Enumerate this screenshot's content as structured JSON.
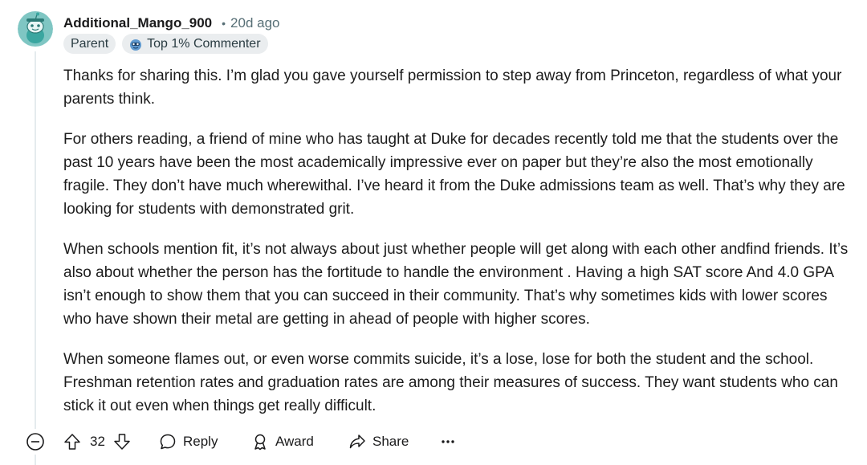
{
  "comment": {
    "username": "Additional_Mango_900",
    "separator": "•",
    "timestamp": "20d ago",
    "avatar_icon": "snoo-avatar-icon",
    "flairs": [
      {
        "label": "Parent"
      },
      {
        "label": "Top 1% Commenter",
        "icon": "commenter-badge-icon"
      }
    ],
    "paragraphs": [
      "Thanks for sharing this. I’m glad you gave yourself permission to step away from Princeton, regardless of what your parents think.",
      "For others reading, a friend of mine who has taught at Duke for decades recently told me that the students over the past 10 years have been the most academically impressive ever on paper but they’re also the most emotionally fragile. They don’t have much wherewithal. I’ve heard it from the Duke admissions team as well. That’s why they are looking for students with demonstrated grit.",
      "When schools mention fit, it’s not always about just whether people will get along with each other andfind friends. It’s also about whether the person has the fortitude to handle the environment . Having a high SAT score And 4.0 GPA isn’t enough to show them that you can succeed in their community. That’s why sometimes kids with lower scores who have shown their metal are getting in ahead of people with higher scores.",
      "When someone flames out, or even worse commits suicide, it’s a lose, lose for both the student and the school. Freshman retention rates and graduation rates are among their measures of success. They want students who can stick it out even when things get really difficult."
    ]
  },
  "actions": {
    "vote_count": "32",
    "reply_label": "Reply",
    "award_label": "Award",
    "share_label": "Share",
    "more_label": "•••"
  },
  "colors": {
    "text": "#1a1a1b",
    "muted": "#576f76",
    "flair_bg": "#eaedef",
    "thread_line": "#e5ebee",
    "avatar_bg": "#7fc6c3"
  }
}
